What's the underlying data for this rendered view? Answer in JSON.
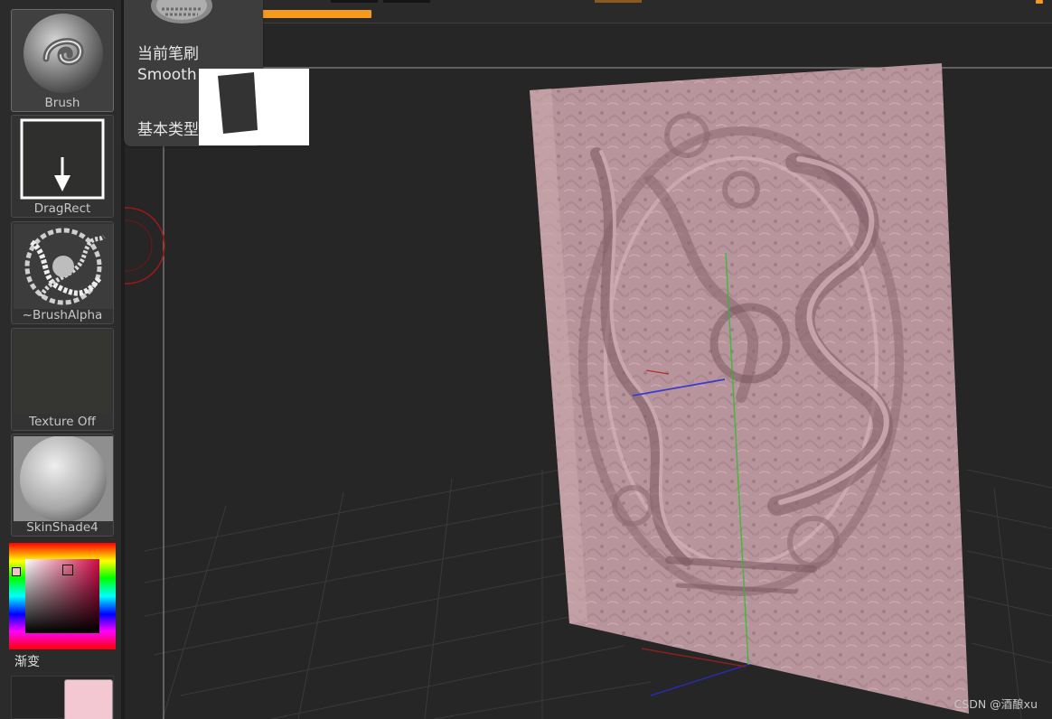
{
  "tooltip": {
    "title": "当前笔刷",
    "brush_name": "Smooth",
    "base_type": "基本类型: 模糊"
  },
  "left_tray": {
    "brush_label": "Brush",
    "stroke_label": "DragRect",
    "alpha_label": "~BrushAlpha",
    "texture_label": "Texture Off",
    "material_label": "SkinShade4",
    "gradient_label": "渐变"
  },
  "colors": {
    "accent": "#f39a1f",
    "relief": "#b8959c",
    "main_color": "#f0c0cc",
    "secondary_color": "#f3c8d2",
    "viewport_bg": "#262626"
  },
  "watermark": "CSDN @酒酿xu"
}
